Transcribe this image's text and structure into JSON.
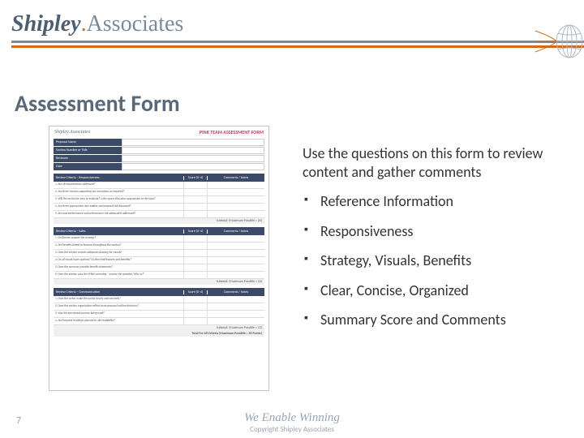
{
  "header": {
    "brand_shipley": "Shipley",
    "brand_dot": ".",
    "brand_assoc": "Associates"
  },
  "title": "Assessment Form",
  "form_preview": {
    "logo_text": "Shipley.Associates",
    "title": "PINK TEAM ASSESSMENT FORM",
    "meta_labels": [
      "Proposal Name",
      "Section Number or Title",
      "Reviewer",
      "Date"
    ],
    "section1": {
      "head": {
        "c1": "Review Criteria – Responsiveness",
        "c2": "Score (0–4)",
        "c3": "Comments / Notes"
      },
      "rows": [
        "1.  Are all requirements addressed?",
        "2.  Are there reasons supporting any exceptions as required?",
        "3.  Will the section be easy to evaluate? Is the space allocation appropriate to the topic?",
        "4.  Are there appropriate case studies and proposal risk discussed?",
        "5.  Are past performance and performance risk adequately addressed?"
      ],
      "subtotal": "Subtotal: (Maximum Possible = 20)"
    },
    "section2": {
      "head": {
        "c1": "Review Criteria – Sales",
        "c2": "Score (0–4)",
        "c3": "Comments / Notes"
      },
      "rows": [
        "1.  Do themes support the strategy?",
        "2.  Are benefits linked to features throughout the section?",
        "3.  Does the section contain adequate planning for visuals?",
        "4.  Do all visuals have captions? Do they link features and benefits?",
        "5.  Does the summary provide benefit statements?",
        "6.  Does the section pass the SFBW screening – answer the question 'Why us?'"
      ],
      "subtotal": "Subtotal: (Maximum Possible = 24)"
    },
    "section3": {
      "head": {
        "c1": "Review Criteria – Communication",
        "c2": "Score (0–4)",
        "c3": "Comments / Notes"
      },
      "rows": [
        "1.  Does the writer make the points clearly and concisely?",
        "2.  Does the section organization reflect team proposal outline decisions?",
        "3.  Was the storyboard process being used?",
        "4.  Are frequent headings planned to aid readability?"
      ],
      "subtotal": "Subtotal: (Maximum Possible = 12)",
      "total": "Total For All Criteria (Maximum Possible = 56 Points)"
    }
  },
  "content": {
    "intro": "Use the questions on this form to review content and gather comments",
    "bullets": [
      "Reference Information",
      "Responsiveness",
      "Strategy, Visuals, Benefits",
      "Clear, Concise, Organized",
      "Summary Score and Comments"
    ]
  },
  "footer": {
    "tagline": "We Enable Winning",
    "copyright": "Copyright Shipley Associates",
    "page": "7"
  }
}
